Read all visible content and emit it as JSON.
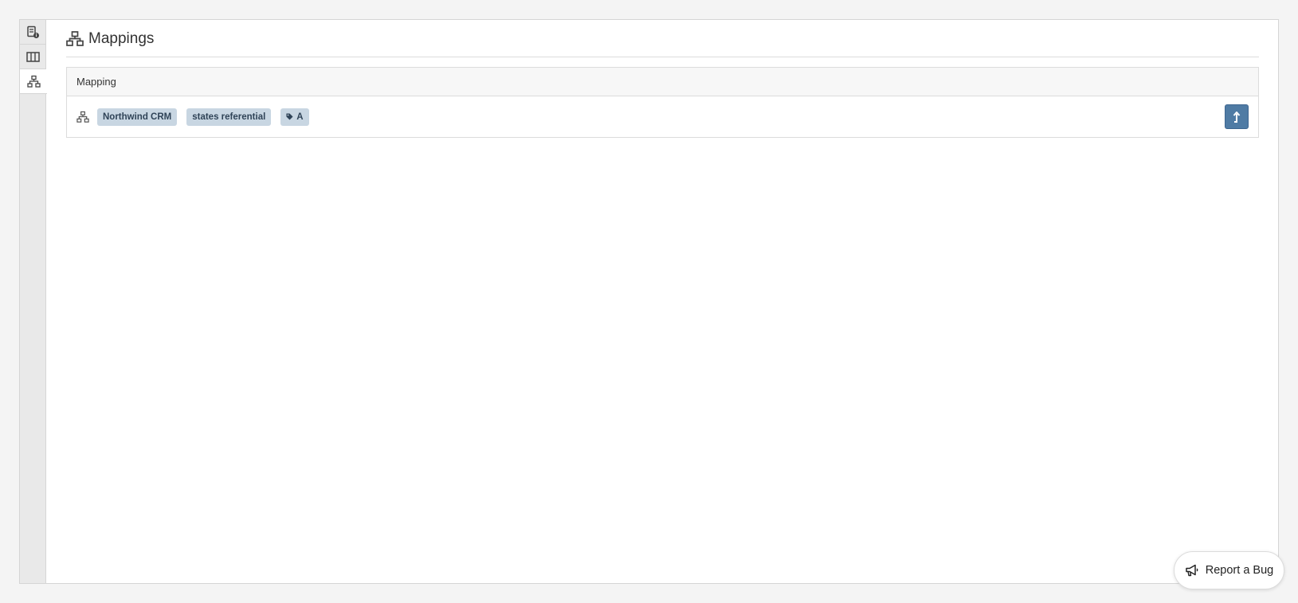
{
  "sidebar": {
    "tabs": [
      {
        "icon": "document-info-icon",
        "active": false
      },
      {
        "icon": "columns-icon",
        "active": false
      },
      {
        "icon": "sitemap-icon",
        "active": true
      }
    ]
  },
  "header": {
    "icon": "sitemap-icon",
    "title": "Mappings"
  },
  "table": {
    "column_header": "Mapping",
    "rows": [
      {
        "icon": "sitemap-icon",
        "tags": [
          {
            "label": "Northwind CRM"
          },
          {
            "label": "states referential"
          },
          {
            "label": "A",
            "icon": "tag-icon"
          }
        ],
        "action_icon": "level-up-arrow-icon"
      }
    ]
  },
  "report_bug": {
    "icon": "bullhorn-icon",
    "label": "Report a Bug"
  },
  "colors": {
    "background": "#f4f4f4",
    "tag_background": "#c8d6e2",
    "tag_text": "#2f4357",
    "action_button": "#4f7ba4"
  }
}
